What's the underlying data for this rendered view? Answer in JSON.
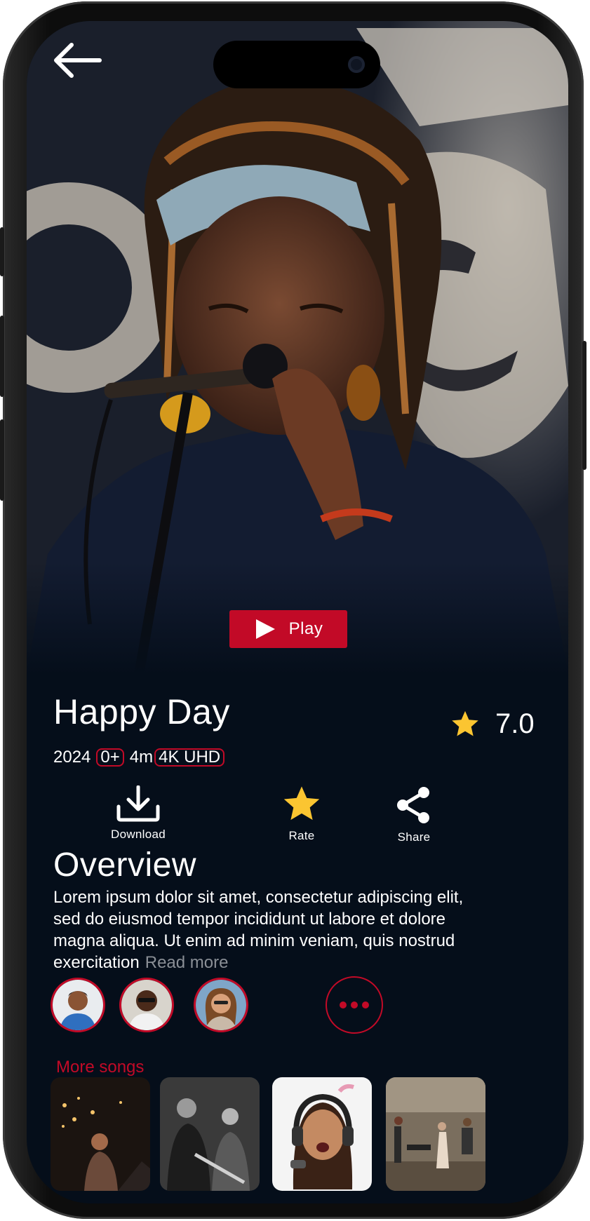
{
  "hero": {
    "back_icon": "arrow-left-icon",
    "play_label": "Play",
    "play_icon": "play-triangle-icon"
  },
  "song": {
    "title": "Happy Day",
    "rating": "7.0",
    "rating_icon": "star-icon",
    "year": "2024",
    "age_rating": "0+",
    "duration": "4m",
    "quality": "4K UHD"
  },
  "actions": {
    "download": {
      "label": "Download",
      "icon": "download-icon"
    },
    "rate": {
      "label": "Rate",
      "icon": "star-icon"
    },
    "share": {
      "label": "Share",
      "icon": "share-icon"
    }
  },
  "overview": {
    "heading": "Overview",
    "text": "Lorem ipsum dolor sit amet, consectetur adipiscing elit, sed do eiusmod tempor incididunt ut labore et dolore magna aliqua. Ut enim ad minim veniam, quis nostrud exercitation",
    "read_more": "Read more"
  },
  "cast": {
    "more_icon": "more-dots-icon"
  },
  "more_songs": {
    "label": "More songs"
  },
  "colors": {
    "accent": "#c20a27",
    "background": "#050e1a",
    "star": "#fbc531",
    "text": "#ffffff",
    "muted": "#8a8f96"
  }
}
